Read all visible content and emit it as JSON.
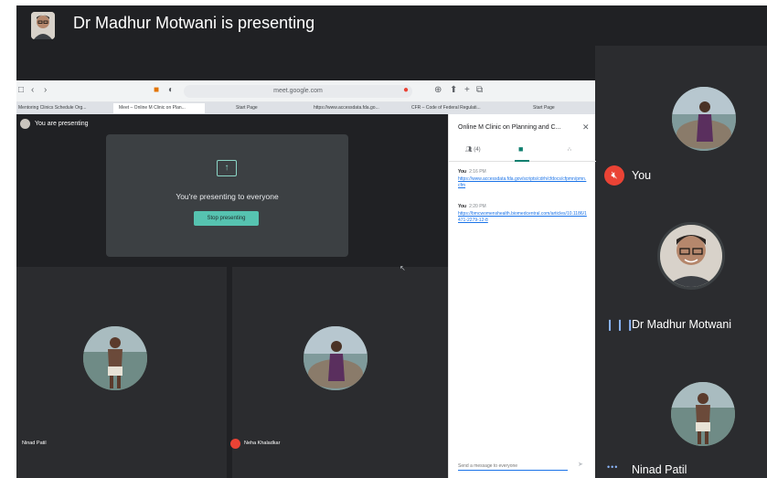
{
  "header": {
    "title": "Dr Madhur Motwani is presenting"
  },
  "right_panel": {
    "participants": [
      {
        "name": "You",
        "status_icon": "mic-off-icon"
      },
      {
        "name": "Dr Madhur Motwani",
        "status_icon": "speaking-icon"
      },
      {
        "name": "Ninad Patil",
        "status_icon": "more-dots-icon"
      }
    ]
  },
  "browser": {
    "url": "meet.google.com",
    "tabs": [
      "Mentoring Clinics Schedule Org...",
      "Meet – Online M Clinic on Plan...",
      "Start Page",
      "https://www.accessdata.fda.go...",
      "CFR – Code of Federal Regulati...",
      "Start Page"
    ]
  },
  "meet_inner": {
    "you_are_presenting": "You are presenting",
    "presenting_message": "You're presenting to everyone",
    "stop_button": "Stop presenting",
    "tiles": [
      {
        "name": "Ninad Patil"
      },
      {
        "name": "Neha Khaladkar"
      }
    ]
  },
  "chat": {
    "title": "Online M Clinic on Planning and C...",
    "people_count": "(4)",
    "messages": [
      {
        "author": "You",
        "time": "2:16 PM",
        "text": "https://www.accessdata.fda.gov/scripts/cdrh/cfdocs/cfpmn/pmn.cfm"
      },
      {
        "author": "You",
        "time": "2:20 PM",
        "text": "https://bmcwomenshealth.biomedcentral.com/articles/10.1186/1471-2279-12-8"
      }
    ],
    "input_placeholder": "Send a message to everyone"
  },
  "colors": {
    "background": "#202124",
    "tile": "#2b2c2f",
    "accent": "#56c3b0",
    "mic_off": "#ea4335"
  }
}
